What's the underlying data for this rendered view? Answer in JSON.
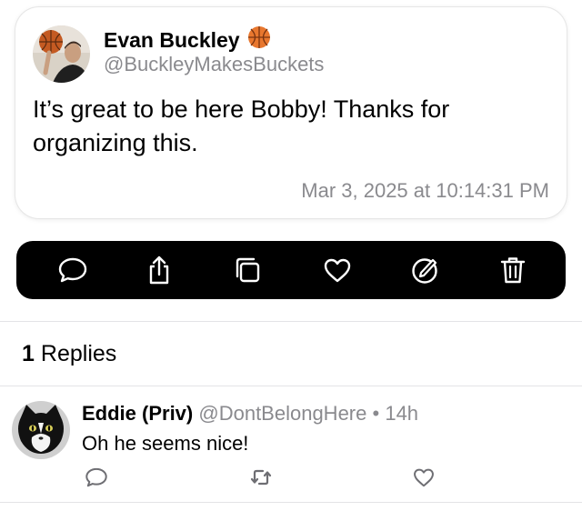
{
  "post": {
    "author_name": "Evan Buckley",
    "author_emoji": "basketball-icon",
    "author_handle": "@BuckleyMakesBuckets",
    "text": "It’s great to be here Bobby! Thanks for organizing this.",
    "timestamp": "Mar 3, 2025 at 10:14:31 PM"
  },
  "action_bar": {
    "buttons": [
      {
        "icon": "reply-bubble-icon"
      },
      {
        "icon": "share-icon"
      },
      {
        "icon": "copy-icon"
      },
      {
        "icon": "like-heart-icon"
      },
      {
        "icon": "edit-icon"
      },
      {
        "icon": "delete-trash-icon"
      }
    ],
    "background": "#000000",
    "icon_color": "#ffffff"
  },
  "replies_section": {
    "count": "1",
    "label": "Replies"
  },
  "replies": [
    {
      "name": "Eddie (Priv)",
      "handle": "@DontBelongHere",
      "separator": "•",
      "time": "14h",
      "text": "Oh he seems nice!",
      "actions": [
        "reply-bubble-icon",
        "repost-icon",
        "like-heart-icon"
      ]
    }
  ],
  "colors": {
    "secondary_text": "#8a8a8e",
    "divider": "#e3e3e6"
  }
}
